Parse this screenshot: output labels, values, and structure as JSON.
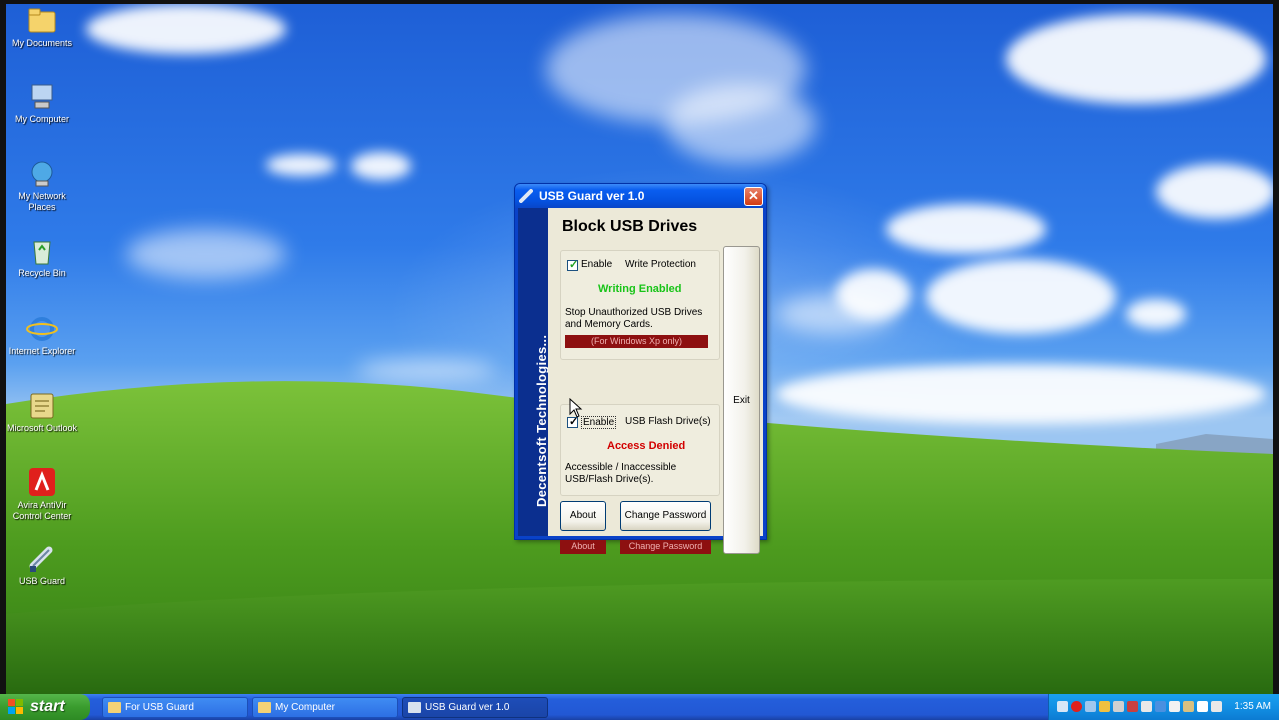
{
  "desktop": {
    "icons": [
      {
        "label": "My Documents",
        "icon": "folder-icon"
      },
      {
        "label": "My Computer",
        "icon": "computer-icon"
      },
      {
        "label": "My Network Places",
        "icon": "network-icon"
      },
      {
        "label": "Recycle Bin",
        "icon": "recycle-bin-icon"
      },
      {
        "label": "Internet Explorer",
        "icon": "internet-explorer-icon"
      },
      {
        "label": "Microsoft Outlook",
        "icon": "outlook-icon"
      },
      {
        "label": "Avira AntiVir Control Center",
        "icon": "avira-icon"
      },
      {
        "label": "USB Guard",
        "icon": "usb-guard-icon"
      }
    ]
  },
  "window": {
    "title": "USB  Guard ver 1.0",
    "close_label": "✕",
    "vendor_band": "Decentsoft Technologies...",
    "heading": "Block USB Drives",
    "write_protection": {
      "checkbox_label": "Enable",
      "checked": true,
      "option": "Write Protection",
      "status": "Writing Enabled",
      "description": "Stop Unauthorized USB Drives and Memory Cards.",
      "note": "(For Windows Xp only)"
    },
    "flash_drive": {
      "checkbox_label": "Enable",
      "checked": true,
      "option": "USB Flash Drive(s)",
      "status": "Access Denied",
      "description": "Accessible / Inaccessible USB/Flash Drive(s)."
    },
    "about_button": "About",
    "change_password_button": "Change Password",
    "about_bar": "About",
    "change_password_bar": "Change Password",
    "exit_button": "Exit"
  },
  "taskbar": {
    "start_label": "start",
    "tasks": [
      {
        "label": "For USB Guard",
        "active": false
      },
      {
        "label": "My Computer",
        "active": false
      },
      {
        "label": "USB  Guard ver 1.0",
        "active": true
      }
    ],
    "clock": "1:35 AM"
  },
  "colors": {
    "status_enabled": "#18c418",
    "status_denied": "#d20000",
    "side_band": "#0b2f8f",
    "titlebar": "#0552e0"
  }
}
